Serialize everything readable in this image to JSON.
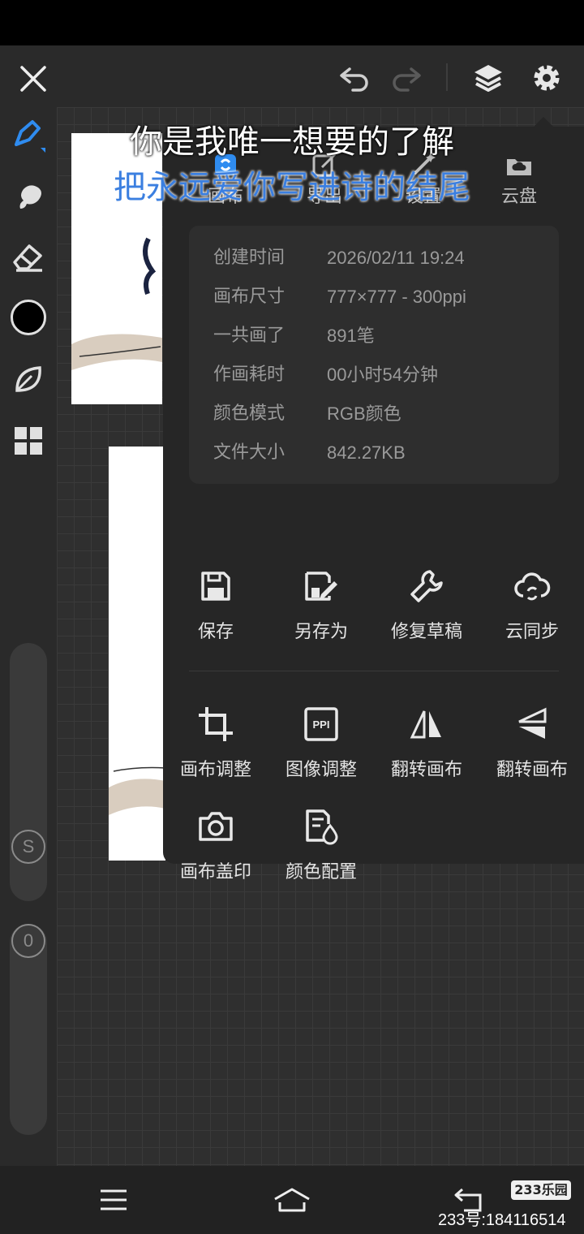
{
  "lyrics": {
    "line1": "你是我唯一想要的了解",
    "line2": "把永远爱你写进诗的结尾"
  },
  "panel": {
    "tabs": [
      {
        "label": "画布",
        "icon": "canvas-icon"
      },
      {
        "label": "导出",
        "icon": "export-icon"
      },
      {
        "label": "设置",
        "icon": "settings-wand-icon"
      },
      {
        "label": "云盘",
        "icon": "cloud-drive-icon"
      }
    ],
    "info": [
      {
        "key": "创建时间",
        "value": "2026/02/11 19:24"
      },
      {
        "key": "画布尺寸",
        "value": "777×777 - 300ppi"
      },
      {
        "key": "一共画了",
        "value": "891笔"
      },
      {
        "key": "作画耗时",
        "value": "00小时54分钟"
      },
      {
        "key": "颜色模式",
        "value": "RGB颜色"
      },
      {
        "key": "文件大小",
        "value": "842.27KB"
      }
    ],
    "actions_row1": [
      {
        "label": "保存",
        "icon": "save-icon"
      },
      {
        "label": "另存为",
        "icon": "save-as-icon"
      },
      {
        "label": "修复草稿",
        "icon": "wrench-icon"
      },
      {
        "label": "云同步",
        "icon": "cloud-sync-icon"
      }
    ],
    "actions_row2": [
      {
        "label": "画布调整",
        "icon": "crop-icon"
      },
      {
        "label": "图像调整",
        "icon": "ppi-icon"
      },
      {
        "label": "翻转画布",
        "icon": "flip-horizontal-icon"
      },
      {
        "label": "翻转画布",
        "icon": "flip-vertical-icon"
      }
    ],
    "actions_row3": [
      {
        "label": "画布盖印",
        "icon": "camera-icon"
      },
      {
        "label": "颜色配置",
        "icon": "color-config-icon"
      }
    ]
  },
  "left_toolbar": {
    "slider_size_label": "S",
    "slider_opacity_label": "0"
  },
  "colors": {
    "accent": "#2f8cf0",
    "current_color": "#000000"
  },
  "watermark": {
    "badge": "233乐园",
    "id": "233号:184116514"
  }
}
